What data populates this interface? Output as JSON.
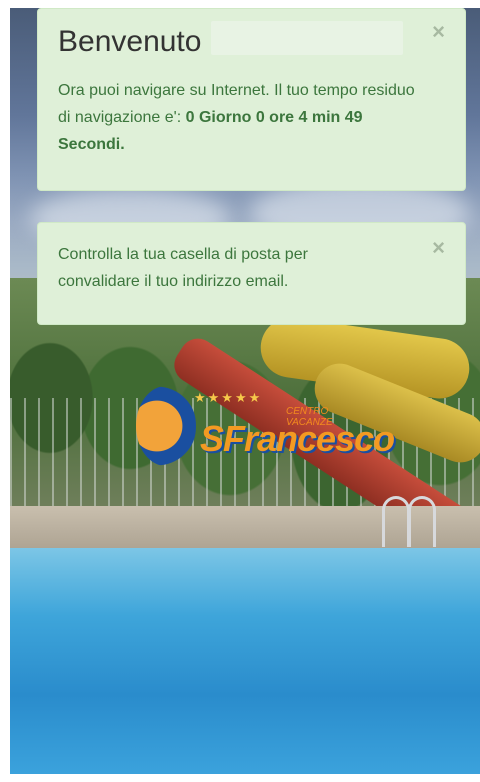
{
  "welcome_alert": {
    "title": "Benvenuto",
    "message": "Ora puoi navigare su Internet. Il tuo tempo residuo di navigazione e':",
    "remaining_time": "0 Giorno 0 ore 4 min 49 Secondi.",
    "close_symbol": "×",
    "close_icon": "close-icon"
  },
  "email_alert": {
    "message": "Controlla la tua casella di posta per convalidare il tuo indirizzo email.",
    "close_symbol": "×",
    "close_icon": "close-icon"
  },
  "logo": {
    "stars": "★★★★★",
    "subtitle": "CENTRO VACANZE",
    "name": "SFrancesco"
  },
  "colors": {
    "alert_background": "#dff0d8",
    "alert_text": "#3c763d",
    "logo_orange": "#f39a22",
    "logo_blue": "#1a4fa0"
  }
}
